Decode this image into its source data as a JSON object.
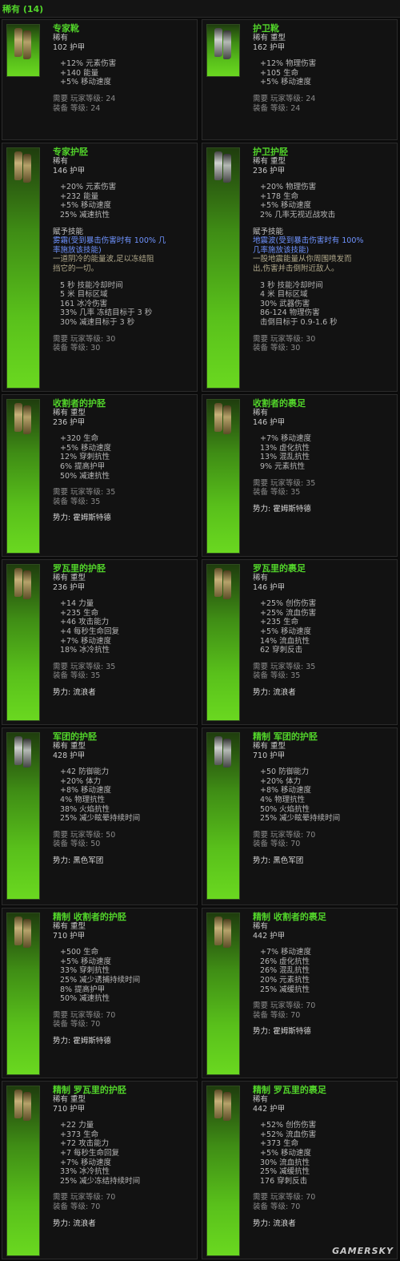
{
  "header": {
    "title": "稀有 (14)"
  },
  "labels": {
    "player_level": "需要 玩家等级:",
    "item_level": "装备 等级:",
    "skill_title": "赋予技能",
    "faction_prefix": "势力:"
  },
  "items": [
    {
      "name": "专家靴",
      "sub": "稀有",
      "armor": "102 护甲",
      "stats": [
        "+12% 元素伤害",
        "+140 能量",
        "+5% 移动速度"
      ],
      "player_level": "24",
      "item_level": "24"
    },
    {
      "name": "护卫靴",
      "sub": "稀有 重型",
      "armor": "162 护甲",
      "stats": [
        "+12% 物理伤害",
        "+105 生命",
        "+5% 移动速度"
      ],
      "player_level": "24",
      "item_level": "24"
    },
    {
      "name": "专家护胫",
      "sub": "稀有",
      "armor": "146 护甲",
      "stats": [
        "+20% 元素伤害",
        "+232 能量",
        "+5% 移动速度",
        "25% 减速抗性"
      ],
      "skill": {
        "name1": "雾霜(受到暴击伤害时有 100% 几",
        "name2": "率施放该技能)",
        "desc1": "一道阴冷的能量波,足以冻结阻",
        "desc2": "挡它的一切。",
        "stats": [
          "5 秒 技能冷却时间",
          "5 米 目标区域",
          "161 冰冷伤害",
          "33% 几率 冻结目标于 3 秒",
          "30% 减速目标于 3 秒"
        ]
      },
      "player_level": "30",
      "item_level": "30"
    },
    {
      "name": "护卫护胫",
      "sub": "稀有 重型",
      "armor": "236 护甲",
      "stats": [
        "+20% 物理伤害",
        "+178 生命",
        "+5% 移动速度",
        "2% 几率无视近战攻击"
      ],
      "skill": {
        "name1": "地震波(受到暴击伤害时有 100%",
        "name2": "几率施放该技能)",
        "desc1": "一股地震能量从你周围喷发而",
        "desc2": "出,伤害并击倒附近敌人。",
        "stats": [
          "3 秒 技能冷却时间",
          "4 米 目标区域",
          "30% 武器伤害",
          "86-124 物理伤害",
          "击倒目标于 0.9-1.6 秒"
        ]
      },
      "player_level": "30",
      "item_level": "30"
    },
    {
      "name": "收割者的护胫",
      "sub": "稀有 重型",
      "armor": "236 护甲",
      "stats": [
        "+320 生命",
        "+5% 移动速度",
        "12% 穿刺抗性",
        "6% 提高护甲",
        "50% 减速抗性"
      ],
      "player_level": "35",
      "item_level": "35",
      "faction": "霍姆斯特德"
    },
    {
      "name": "收割者的裹足",
      "sub": "稀有",
      "armor": "146 护甲",
      "stats": [
        "+7% 移动速度",
        "13% 虚化抗性",
        "13% 混乱抗性",
        "9% 元素抗性"
      ],
      "player_level": "35",
      "item_level": "35",
      "faction": "霍姆斯特德"
    },
    {
      "name": "罗瓦里的护胫",
      "sub": "稀有 重型",
      "armor": "236 护甲",
      "stats": [
        "+14 力量",
        "+235 生命",
        "+46 攻击能力",
        "+4 每秒生命回复",
        "+7% 移动速度",
        "18% 冰冷抗性"
      ],
      "player_level": "35",
      "item_level": "35",
      "faction": "流浪者"
    },
    {
      "name": "罗瓦里的裹足",
      "sub": "稀有",
      "armor": "146 护甲",
      "stats": [
        "+25% 创伤伤害",
        "+25% 流血伤害",
        "+235 生命",
        "+5% 移动速度",
        "14% 流血抗性",
        "62 穿刺反击"
      ],
      "player_level": "35",
      "item_level": "35",
      "faction": "流浪者"
    },
    {
      "name": "军团的护胫",
      "sub": "稀有 重型",
      "armor": "428 护甲",
      "stats": [
        "+42 防御能力",
        "+20% 体力",
        "+8% 移动速度",
        "4% 物理抗性",
        "38% 火焰抗性",
        "25% 减少眩晕持续时间"
      ],
      "player_level": "50",
      "item_level": "50",
      "faction": "黑色军团"
    },
    {
      "name": "精制 军团的护胫",
      "sub": "稀有 重型",
      "armor": "710 护甲",
      "stats": [
        "+50 防御能力",
        "+20% 体力",
        "+8% 移动速度",
        "4% 物理抗性",
        "50% 火焰抗性",
        "25% 减少眩晕持续时间"
      ],
      "player_level": "70",
      "item_level": "70",
      "faction": "黑色军团"
    },
    {
      "name": "精制 收割者的护胫",
      "sub": "稀有 重型",
      "armor": "710 护甲",
      "stats": [
        "+500 生命",
        "+5% 移动速度",
        "33% 穿刺抗性",
        "25% 减少诱捕持续时间",
        "8% 提高护甲",
        "50% 减速抗性"
      ],
      "player_level": "70",
      "item_level": "70",
      "faction": "霍姆斯特德"
    },
    {
      "name": "精制 收割者的裹足",
      "sub": "稀有",
      "armor": "442 护甲",
      "stats": [
        "+7% 移动速度",
        "26% 虚化抗性",
        "26% 混乱抗性",
        "20% 元素抗性",
        "25% 减缓抗性"
      ],
      "player_level": "70",
      "item_level": "70",
      "faction": "霍姆斯特德"
    },
    {
      "name": "精制 罗瓦里的护胫",
      "sub": "稀有 重型",
      "armor": "710 护甲",
      "stats": [
        "+22 力量",
        "+373 生命",
        "+72 攻击能力",
        "+7 每秒生命回复",
        "+7% 移动速度",
        "33% 冰冷抗性",
        "25% 减少冻结持续时间"
      ],
      "player_level": "70",
      "item_level": "70",
      "faction": "流浪者"
    },
    {
      "name": "精制 罗瓦里的裹足",
      "sub": "稀有",
      "armor": "442 护甲",
      "stats": [
        "+52% 创伤伤害",
        "+52% 流血伤害",
        "+373 生命",
        "+5% 移动速度",
        "30% 流血抗性",
        "25% 减缓抗性",
        "176 穿刺反击"
      ],
      "player_level": "70",
      "item_level": "70",
      "faction": "流浪者"
    }
  ],
  "watermark": "GAMERSKY"
}
